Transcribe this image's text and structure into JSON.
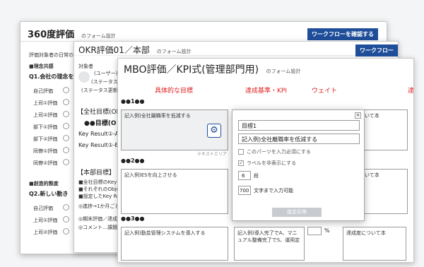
{
  "w1": {
    "title": "360度評価",
    "subtitle": "のフォーム設計",
    "workflow_btn": "ワークフローを確認する",
    "desc": "評価対象者の日常の",
    "section1": "■理念共感",
    "q1": "Q1.会社の理念を",
    "rows1": [
      "自己評価",
      "上司①評価",
      "上司②評価",
      "部下①評価",
      "部下②評価",
      "同僚①評価",
      "同僚②評価"
    ],
    "section2": "■創造的態度",
    "q2": "Q2.新しい動き",
    "rows2": [
      "自己評価",
      "上司①評価",
      "上司②評価"
    ]
  },
  "w2": {
    "title": "OKR評価01／本部",
    "subtitle": "のフォーム設計",
    "workflow_btn": "ワークフロー",
    "target_label": "対象者",
    "user": "(ユーザー)",
    "status": "(ステータス)",
    "status_updated": "(ステータス更新日",
    "all_goal": "【全社目標(Ob",
    "goal_line": "●●目標(O",
    "kr_a": "Key Result①-A",
    "kr_b": "Key Result①-B",
    "dept_goal": "【本部目標】",
    "notes": [
      "■全社目標のKey",
      "■それぞれのObjective",
      "■設定したKey Result",
      "◎進捗→1か月ごとの"
    ],
    "notes2": [
      "◎期末評価／達成率…",
      "◎コメント…課題お"
    ]
  },
  "w3": {
    "title": "MBO評価／KPI式(管理部門用)",
    "subtitle": "のフォーム設計",
    "col_goal": "具体的な目標",
    "col_standard": "達成基準・KPI",
    "col_weight": "ウェイト",
    "col_extra": "達",
    "sec1": "●●1●●",
    "ex1": "記入例)全社離職率を低減する",
    "sec2": "●●2●●",
    "ex2": "記入例)ESを向上させる",
    "sec3": "●●3●●",
    "ex3": "記入例)勤怠管理システムを導入する",
    "ex3_std": "記入例)導入完了でA、マニュアル整備完了でS、運用定",
    "percent": "%",
    "achievement": "達成度について本",
    "about_label": "について本",
    "text_area_label": "テキストエリア"
  },
  "popup": {
    "field1": "目標1",
    "field2": "記入例)全社離職率を低減する",
    "required": "このパーツを入力必須にする",
    "hide_label": "ラベルを非表示にする",
    "rows_value": "6",
    "rows_unit": "段",
    "chars_value": "700",
    "chars_unit": "文字まで入力可能",
    "apply_btn": "設定反映",
    "close": "×"
  }
}
